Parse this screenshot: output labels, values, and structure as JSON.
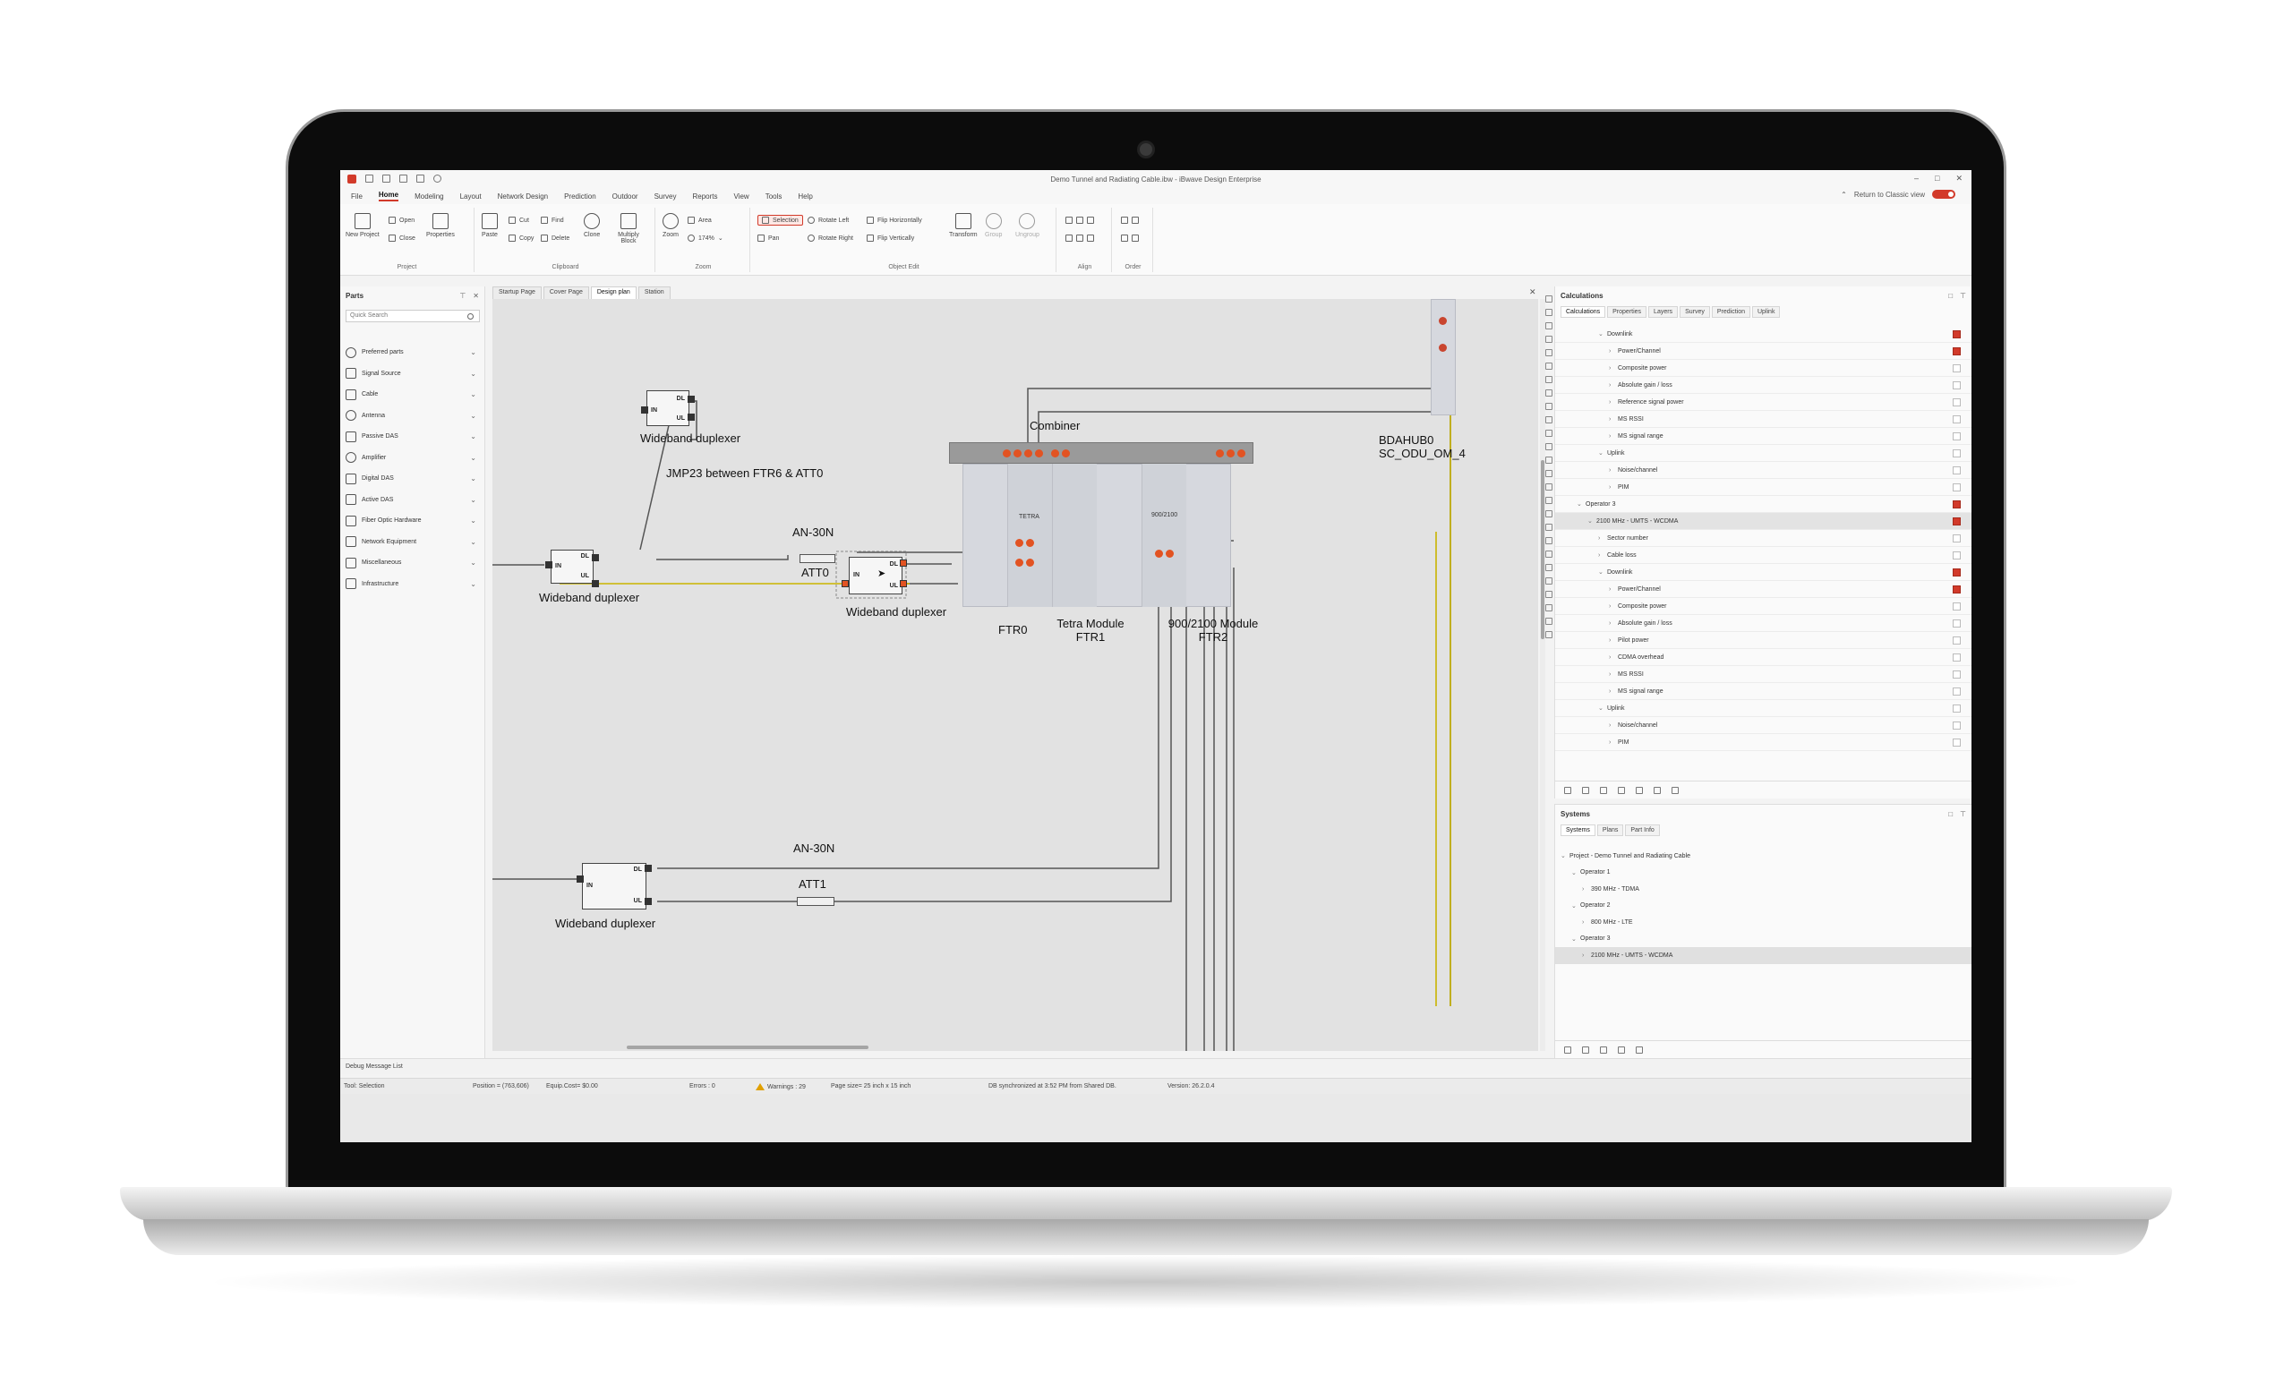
{
  "window": {
    "title": "Demo Tunnel and Radiating Cable.ibw - iBwave Design Enterprise",
    "return_classic": "Return to Classic view"
  },
  "menu": [
    "File",
    "Home",
    "Modeling",
    "Layout",
    "Network Design",
    "Prediction",
    "Outdoor",
    "Survey",
    "Reports",
    "View",
    "Tools",
    "Help"
  ],
  "ribbon": {
    "project": {
      "label": "Project",
      "new_project": "New Project",
      "open": "Open",
      "close": "Close",
      "properties": "Properties"
    },
    "clipboard": {
      "label": "Clipboard",
      "paste": "Paste",
      "cut": "Cut",
      "copy": "Copy",
      "find": "Find",
      "delete": "Delete",
      "clone": "Clone",
      "multiply": "Multiply Block"
    },
    "zoom": {
      "label": "Zoom",
      "zoom": "Zoom",
      "area": "Area",
      "level": "174%"
    },
    "object_edit": {
      "label": "Object Edit",
      "selection": "Selection",
      "pan": "Pan",
      "rotate_left": "Rotate Left",
      "rotate_right": "Rotate Right",
      "flip_h": "Flip Horizontally",
      "flip_v": "Flip Vertically",
      "transform": "Transform",
      "group": "Group",
      "ungroup": "Ungroup"
    },
    "align": {
      "label": "Align"
    },
    "order": {
      "label": "Order"
    }
  },
  "parts": {
    "title": "Parts",
    "search_placeholder": "Quick Search",
    "items": [
      "Preferred parts",
      "Signal Source",
      "Cable",
      "Antenna",
      "Passive DAS",
      "Amplifier",
      "Digital DAS",
      "Active DAS",
      "Fiber Optic Hardware",
      "Network Equipment",
      "Miscellaneous",
      "Infrastructure"
    ]
  },
  "doc_tabs": [
    "Startup Page",
    "Cover Page",
    "Design plan",
    "Station"
  ],
  "canvas": {
    "duplexer_label": "Wideband duplexer",
    "port_in": "IN",
    "port_dl": "DL",
    "port_ul": "UL",
    "jumper_label": "JMP23 between FTR6 & ATT0",
    "att_model": "AN-30N",
    "att0": "ATT0",
    "att1": "ATT1",
    "combiner": "Combiner",
    "tetra": "TETRA",
    "band_900_2100": "900/2100",
    "ftr0": "FTR0",
    "tetra_module": "Tetra Module",
    "ftr1": "FTR1",
    "module_900_2100": "900/2100 Module",
    "ftr2": "FTR2",
    "hub_line1": "BDAHUB0",
    "hub_line2": "SC_ODU_OM_4"
  },
  "calculations": {
    "title": "Calculations",
    "tabs": [
      "Calculations",
      "Properties",
      "Layers",
      "Survey",
      "Prediction",
      "Uplink"
    ],
    "rows": [
      {
        "text": "Downlink",
        "indent": 3,
        "arrow": "v",
        "check": "on"
      },
      {
        "text": "Power/Channel",
        "indent": 4,
        "arrow": ">",
        "check": "on"
      },
      {
        "text": "Composite power",
        "indent": 4,
        "arrow": ">",
        "check": "off"
      },
      {
        "text": "Absolute gain / loss",
        "indent": 4,
        "arrow": ">",
        "check": "off"
      },
      {
        "text": "Reference signal power",
        "indent": 4,
        "arrow": ">",
        "check": "off"
      },
      {
        "text": "MS RSSI",
        "indent": 4,
        "arrow": ">",
        "check": "off"
      },
      {
        "text": "MS signal range",
        "indent": 4,
        "arrow": ">",
        "check": "off"
      },
      {
        "text": "Uplink",
        "indent": 3,
        "arrow": "v",
        "check": "off"
      },
      {
        "text": "Noise/channel",
        "indent": 4,
        "arrow": ">",
        "check": "off"
      },
      {
        "text": "PIM",
        "indent": 4,
        "arrow": ">",
        "check": "off"
      },
      {
        "text": "Operator 3",
        "indent": 1,
        "arrow": "v",
        "check": "on"
      },
      {
        "text": "2100 MHz - UMTS - WCDMA",
        "indent": 2,
        "arrow": "v",
        "check": "on",
        "selected": true
      },
      {
        "text": "Sector number",
        "indent": 3,
        "arrow": ">",
        "check": "off"
      },
      {
        "text": "Cable loss",
        "indent": 3,
        "arrow": ">",
        "check": "off"
      },
      {
        "text": "Downlink",
        "indent": 3,
        "arrow": "v",
        "check": "on"
      },
      {
        "text": "Power/Channel",
        "indent": 4,
        "arrow": ">",
        "check": "on"
      },
      {
        "text": "Composite power",
        "indent": 4,
        "arrow": ">",
        "check": "off"
      },
      {
        "text": "Absolute gain / loss",
        "indent": 4,
        "arrow": ">",
        "check": "off"
      },
      {
        "text": "Pilot power",
        "indent": 4,
        "arrow": ">",
        "check": "off"
      },
      {
        "text": "CDMA overhead",
        "indent": 4,
        "arrow": ">",
        "check": "off"
      },
      {
        "text": "MS RSSI",
        "indent": 4,
        "arrow": ">",
        "check": "off"
      },
      {
        "text": "MS signal range",
        "indent": 4,
        "arrow": ">",
        "check": "off"
      },
      {
        "text": "Uplink",
        "indent": 3,
        "arrow": "v",
        "check": "off"
      },
      {
        "text": "Noise/channel",
        "indent": 4,
        "arrow": ">",
        "check": "off"
      },
      {
        "text": "PIM",
        "indent": 4,
        "arrow": ">",
        "check": "off"
      }
    ]
  },
  "systems": {
    "title": "Systems",
    "tabs": [
      "Systems",
      "Plans",
      "Part Info"
    ],
    "rows": [
      {
        "text": "Project - Demo Tunnel and Radiating Cable",
        "indent": 0,
        "arrow": "v"
      },
      {
        "text": "Operator 1",
        "indent": 1,
        "arrow": "v"
      },
      {
        "text": "390 MHz - TDMA",
        "indent": 2,
        "arrow": ">"
      },
      {
        "text": "Operator 2",
        "indent": 1,
        "arrow": "v"
      },
      {
        "text": "800 MHz - LTE",
        "indent": 2,
        "arrow": ">"
      },
      {
        "text": "Operator 3",
        "indent": 1,
        "arrow": "v"
      },
      {
        "text": "2100 MHz - UMTS - WCDMA",
        "indent": 2,
        "arrow": ">",
        "selected": true
      }
    ]
  },
  "debug": {
    "label": "Debug Message List"
  },
  "status": {
    "tool": "Tool: Selection",
    "position": "Position = (763,606)",
    "equip_cost": "Equip.Cost= $0.00",
    "errors": "Errors : 0",
    "warnings": "Warnings : 29",
    "page_size": "Page size= 25 inch x 15 inch",
    "db_sync": "DB synchronized at 3:52 PM from Shared DB.",
    "version": "Version: 26.2.0.4"
  },
  "colors": {
    "accent": "#d23a2a",
    "port_orange": "#e25322",
    "link_yellow": "#c9b400"
  }
}
